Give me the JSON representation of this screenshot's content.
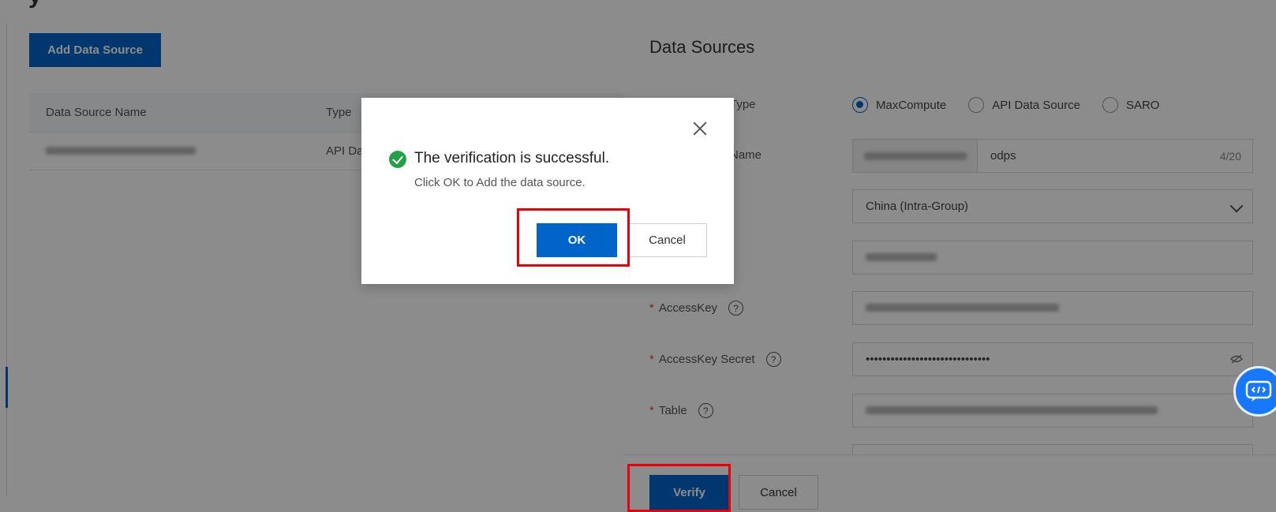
{
  "page": {
    "add_button": "Add Data Source",
    "table": {
      "headers": [
        "Data Source Name",
        "Type"
      ],
      "rows": [
        {
          "type": "API Da"
        }
      ]
    }
  },
  "drawer": {
    "title": "Data Sources",
    "type_label": "Type",
    "type_options": [
      "MaxCompute",
      "API Data Source",
      "SARO"
    ],
    "type_selected": "MaxCompute",
    "name_label": "Name",
    "name_value": "odps",
    "name_count": "4/20",
    "region_value": "China (Intra-Group)",
    "accesskey_label": "AccessKey",
    "accesskey_secret_label": "AccessKey Secret",
    "accesskey_secret_value": "••••••••••••••••••••••••••••••",
    "table_label": "Table",
    "required_mark": "*",
    "help_icon_glyph": "?",
    "verify_button": "Verify",
    "cancel_button": "Cancel"
  },
  "modal": {
    "title": "The verification is successful.",
    "message": "Click OK to Add the data source.",
    "ok_button": "OK",
    "cancel_button": "Cancel"
  },
  "icons": {
    "success": "check-circle-icon",
    "close": "close-icon",
    "help": "question-circle-icon",
    "eye": "eye-off-icon",
    "chevron": "chevron-down-icon",
    "float": "code-chat-icon"
  },
  "colors": {
    "primary": "#0064c8",
    "success": "#24a148",
    "highlight": "#e8000b",
    "required": "#e5462a"
  }
}
